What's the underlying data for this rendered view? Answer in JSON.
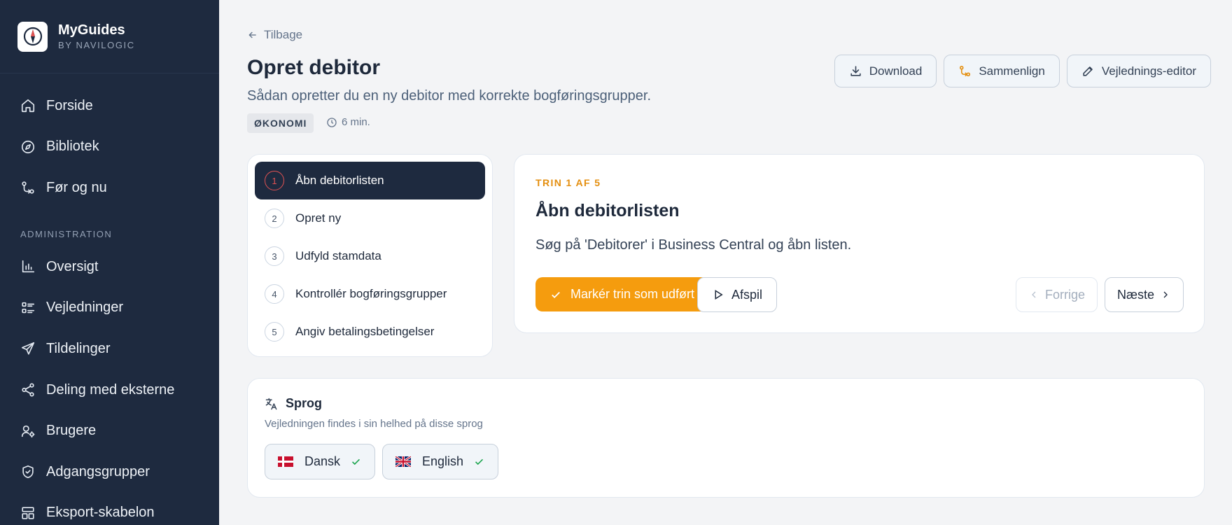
{
  "brand": {
    "name": "MyGuides",
    "sub": "BY NAVILOGIC"
  },
  "sidebar": {
    "items": [
      {
        "label": "Forside",
        "icon": "home-icon"
      },
      {
        "label": "Bibliotek",
        "icon": "compass-icon"
      },
      {
        "label": "Før og nu",
        "icon": "git-compare-icon"
      }
    ],
    "section_label": "ADMINISTRATION",
    "admin_items": [
      {
        "label": "Oversigt",
        "icon": "bar-chart-icon"
      },
      {
        "label": "Vejledninger",
        "icon": "list-icon"
      },
      {
        "label": "Tildelinger",
        "icon": "send-icon"
      },
      {
        "label": "Deling med eksterne",
        "icon": "share-icon"
      },
      {
        "label": "Brugere",
        "icon": "user-cog-icon"
      },
      {
        "label": "Adgangsgrupper",
        "icon": "shield-icon"
      },
      {
        "label": "Eksport-skabelon",
        "icon": "layout-icon"
      }
    ]
  },
  "header": {
    "back": "Tilbage",
    "title": "Opret debitor",
    "subtitle": "Sådan opretter du en ny debitor med korrekte bogføringsgrupper.",
    "tag": "ØKONOMI",
    "duration": "6 min.",
    "buttons": {
      "download": "Download",
      "compare": "Sammenlign",
      "editor": "Vejlednings-editor"
    }
  },
  "steps": [
    {
      "num": "1",
      "label": "Åbn debitorlisten",
      "active": true
    },
    {
      "num": "2",
      "label": "Opret ny",
      "active": false
    },
    {
      "num": "3",
      "label": "Udfyld stamdata",
      "active": false
    },
    {
      "num": "4",
      "label": "Kontrollér bogføringsgrupper",
      "active": false
    },
    {
      "num": "5",
      "label": "Angiv betalingsbetingelser",
      "active": false
    }
  ],
  "detail": {
    "kicker": "TRIN 1 AF 5",
    "title": "Åbn debitorlisten",
    "description": "Søg på 'Debitorer' i Business Central og åbn listen.",
    "mark_done": "Markér trin som udført",
    "play": "Afspil",
    "prev": "Forrige",
    "next": "Næste"
  },
  "languages": {
    "title": "Sprog",
    "subtitle": "Vejledningen findes i sin helhed på disse sprog",
    "items": [
      {
        "label": "Dansk",
        "flag": "denmark-flag"
      },
      {
        "label": "English",
        "flag": "uk-flag"
      }
    ]
  },
  "colors": {
    "sidebar_bg": "#1e2a3f",
    "accent": "#f59c0e",
    "kicker": "#e48f10",
    "active_step_ring": "#e05252",
    "check": "#16a34a"
  }
}
